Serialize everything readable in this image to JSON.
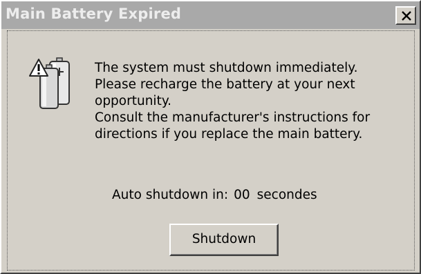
{
  "window": {
    "title": "Main Battery Expired",
    "close_glyph": "close-icon"
  },
  "message": {
    "lines": [
      "The system must shutdown immediately.",
      "Please recharge the battery at your next",
      "opportunity.",
      "Consult the manufacturer's instructions for",
      "directions if you replace the main battery."
    ]
  },
  "countdown": {
    "label": "Auto shutdown in:",
    "value": "00",
    "unit": "secondes"
  },
  "buttons": {
    "shutdown_label": "Shutdown"
  },
  "icons": {
    "warning": "warning-battery-icon",
    "close": "close-icon"
  },
  "colors": {
    "dialog_bg": "#d4d0c8",
    "titlebar_bg": "#a9a9a9",
    "title_text": "#ededed"
  }
}
